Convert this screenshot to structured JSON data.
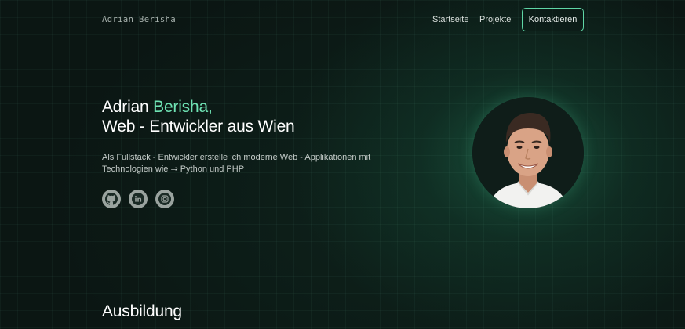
{
  "header": {
    "brand": "Adrian Berisha",
    "nav": [
      {
        "label": "Startseite",
        "active": true
      },
      {
        "label": "Projekte",
        "active": false
      }
    ],
    "cta_label": "Kontaktieren"
  },
  "hero": {
    "name_first": "Adrian ",
    "name_accent": "Berisha,",
    "subtitle": "Web - Entwickler aus Wien",
    "description": "Als Fullstack - Entwickler erstelle ich moderne Web - Applikationen mit Technologien wie ⇒ Python und PHP",
    "socials": [
      {
        "icon": "github-icon"
      },
      {
        "icon": "linkedin-icon"
      },
      {
        "icon": "instagram-icon"
      }
    ]
  },
  "sections": {
    "education_title": "Ausbildung"
  },
  "colors": {
    "background": "#0b1613",
    "accent": "#6fe3b4",
    "button_border": "#5fd6a6",
    "icon_bg": "#9aa39f"
  }
}
